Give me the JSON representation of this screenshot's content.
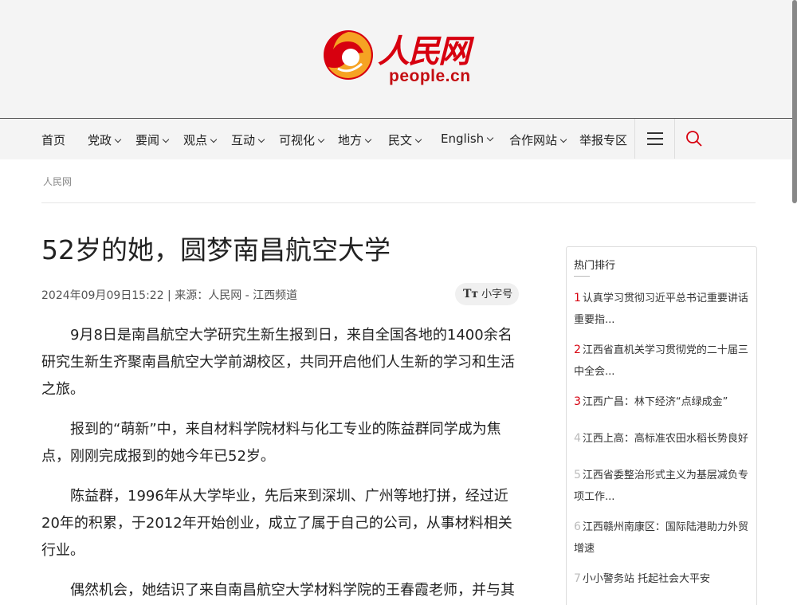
{
  "logo": {
    "cn": "人民网",
    "en": "people.cn",
    "brand_color": "#d7000f"
  },
  "nav": {
    "items": [
      {
        "label": "首页",
        "dropdown": false
      },
      {
        "label": "党政",
        "dropdown": true
      },
      {
        "label": "要闻",
        "dropdown": true
      },
      {
        "label": "观点",
        "dropdown": true
      },
      {
        "label": "互动",
        "dropdown": true
      },
      {
        "label": "可视化",
        "dropdown": true
      },
      {
        "label": "地方",
        "dropdown": true
      },
      {
        "label": "民文",
        "dropdown": true
      },
      {
        "label": "English",
        "dropdown": true
      },
      {
        "label": "合作网站",
        "dropdown": true
      },
      {
        "label": "举报专区",
        "dropdown": false
      }
    ],
    "menu_icon": "hamburger-icon",
    "search_icon": "search-icon"
  },
  "breadcrumb": "人民网",
  "article": {
    "title": "52岁的她，圆梦南昌航空大学",
    "meta": "2024年09月09日15:22 | 来源：人民网 - 江西频道",
    "font_toggle": {
      "icon": "Tт",
      "label": "小字号"
    },
    "paragraphs": [
      "9月8日是南昌航空大学研究生新生报到日，来自全国各地的1400余名研究生新生齐聚南昌航空大学前湖校区，共同开启他们人生新的学习和生活之旅。",
      "报到的“萌新”中，来自材料学院材料与化工专业的陈益群同学成为焦点，刚刚完成报到的她今年已52岁。",
      "陈益群，1996年从大学毕业，先后来到深圳、广州等地打拼，经过近20年的积累，于2012年开始创业，成立了属于自己的公司，从事材料相关行业。",
      "偶然机会，她结识了来自南昌航空大学材料学院的王春霞老师，并与其"
    ]
  },
  "sidebar": {
    "title": "热门排行",
    "items": [
      {
        "rank": "1",
        "text": "认真学习贯彻习近平总书记重要讲话重要指...",
        "hot": true
      },
      {
        "rank": "2",
        "text": "江西省直机关学习贯彻党的二十届三中全会...",
        "hot": true
      },
      {
        "rank": "3",
        "text": "江西广昌：林下经济“点绿成金”",
        "hot": true
      },
      {
        "rank": "4",
        "text": "江西上高：高标准农田水稻长势良好",
        "hot": false
      },
      {
        "rank": "5",
        "text": "江西省委整治形式主义为基层减负专项工作...",
        "hot": false
      },
      {
        "rank": "6",
        "text": "江西赣州南康区：国际陆港助力外贸增速",
        "hot": false
      },
      {
        "rank": "7",
        "text": "小小警务站 托起社会大平安",
        "hot": false
      }
    ]
  }
}
